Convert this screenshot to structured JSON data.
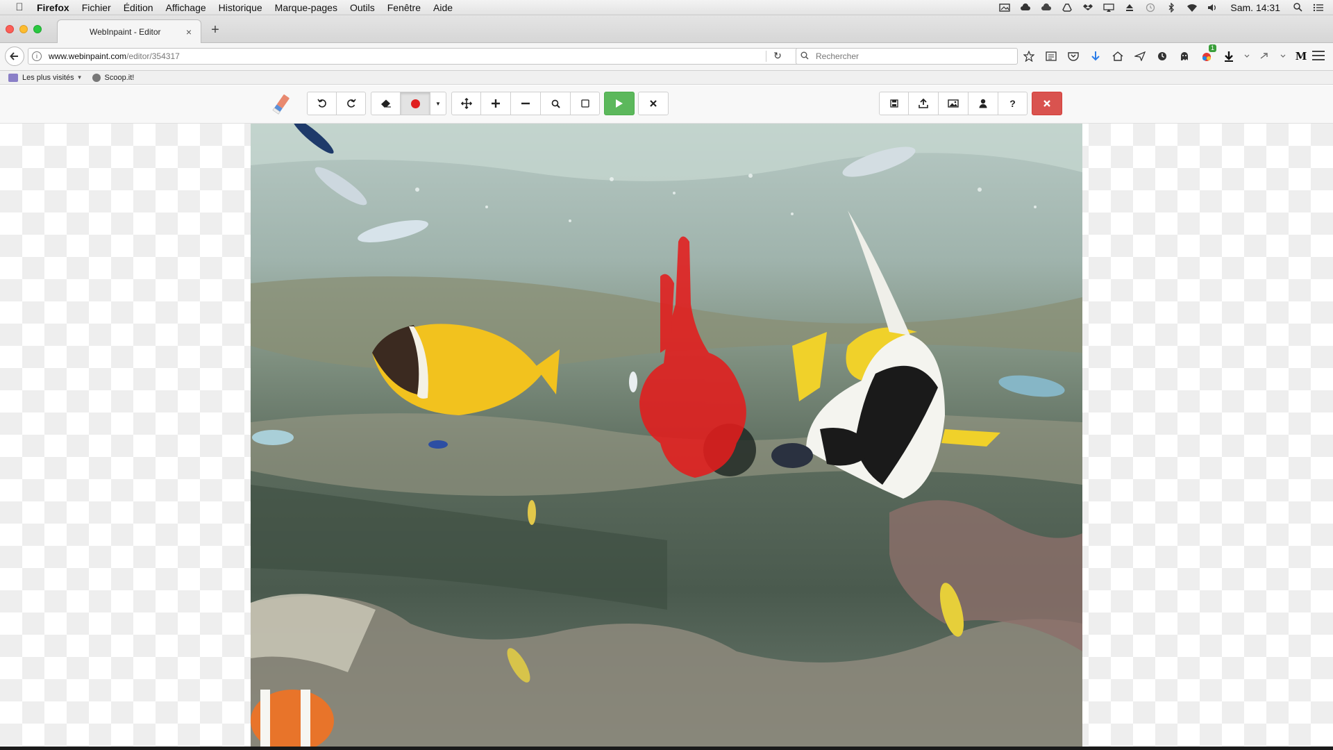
{
  "menubar": {
    "app_name": "Firefox",
    "items": [
      "Fichier",
      "Édition",
      "Affichage",
      "Historique",
      "Marque-pages",
      "Outils",
      "Fenêtre",
      "Aide"
    ],
    "status_icons": [
      "image-capture-icon",
      "creative-cloud-icon",
      "cloud-icon",
      "drive-icon",
      "dropbox-icon",
      "airplay-icon",
      "eject-icon",
      "time-machine-icon",
      "bluetooth-icon",
      "wifi-icon",
      "volume-icon"
    ],
    "clock": "Sam. 14:31"
  },
  "tab": {
    "title": "WebInpaint - Editor"
  },
  "navbar": {
    "url_host": "www.webinpaint.com",
    "url_path": "/editor/354317",
    "search_placeholder": "Rechercher",
    "extension_badge": "1"
  },
  "bookmarks": {
    "items": [
      {
        "label": "Les plus visités",
        "icon": "folder-icon",
        "has_dropdown": true
      },
      {
        "label": "Scoop.it!",
        "icon": "scoopit-icon",
        "has_dropdown": false
      }
    ]
  },
  "toolbar": {
    "left_buttons": [
      "undo-icon",
      "redo-icon",
      "eraser-icon",
      "red-marker-icon",
      "caret-down-icon",
      "move-icon",
      "zoom-in-icon",
      "zoom-out-icon",
      "search-icon",
      "fit-icon",
      "play-icon",
      "close-icon"
    ],
    "right_buttons": [
      "save-icon",
      "upload-icon",
      "image-icon",
      "user-icon",
      "help-icon",
      "close-icon"
    ],
    "accent_green": "#5cb85c",
    "accent_red": "#d9534f",
    "marker_color": "#e02020"
  }
}
